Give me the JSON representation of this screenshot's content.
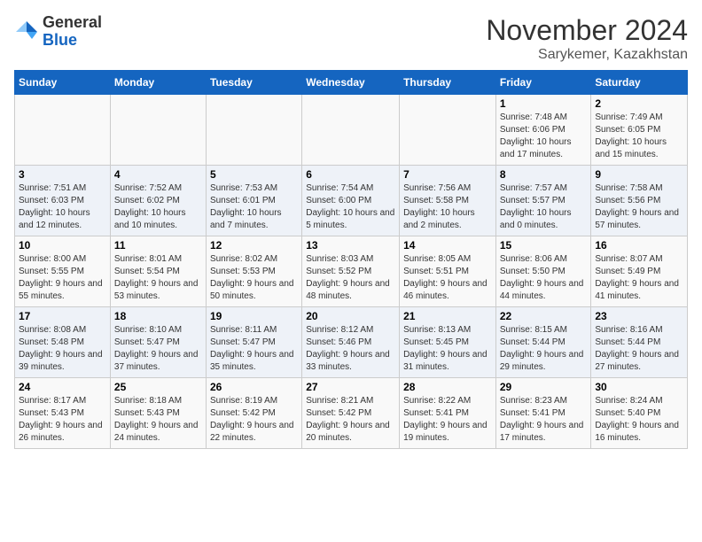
{
  "header": {
    "logo_general": "General",
    "logo_blue": "Blue",
    "month_title": "November 2024",
    "location": "Sarykemer, Kazakhstan"
  },
  "weekdays": [
    "Sunday",
    "Monday",
    "Tuesday",
    "Wednesday",
    "Thursday",
    "Friday",
    "Saturday"
  ],
  "weeks": [
    [
      {
        "day": "",
        "info": ""
      },
      {
        "day": "",
        "info": ""
      },
      {
        "day": "",
        "info": ""
      },
      {
        "day": "",
        "info": ""
      },
      {
        "day": "",
        "info": ""
      },
      {
        "day": "1",
        "info": "Sunrise: 7:48 AM\nSunset: 6:06 PM\nDaylight: 10 hours and 17 minutes."
      },
      {
        "day": "2",
        "info": "Sunrise: 7:49 AM\nSunset: 6:05 PM\nDaylight: 10 hours and 15 minutes."
      }
    ],
    [
      {
        "day": "3",
        "info": "Sunrise: 7:51 AM\nSunset: 6:03 PM\nDaylight: 10 hours and 12 minutes."
      },
      {
        "day": "4",
        "info": "Sunrise: 7:52 AM\nSunset: 6:02 PM\nDaylight: 10 hours and 10 minutes."
      },
      {
        "day": "5",
        "info": "Sunrise: 7:53 AM\nSunset: 6:01 PM\nDaylight: 10 hours and 7 minutes."
      },
      {
        "day": "6",
        "info": "Sunrise: 7:54 AM\nSunset: 6:00 PM\nDaylight: 10 hours and 5 minutes."
      },
      {
        "day": "7",
        "info": "Sunrise: 7:56 AM\nSunset: 5:58 PM\nDaylight: 10 hours and 2 minutes."
      },
      {
        "day": "8",
        "info": "Sunrise: 7:57 AM\nSunset: 5:57 PM\nDaylight: 10 hours and 0 minutes."
      },
      {
        "day": "9",
        "info": "Sunrise: 7:58 AM\nSunset: 5:56 PM\nDaylight: 9 hours and 57 minutes."
      }
    ],
    [
      {
        "day": "10",
        "info": "Sunrise: 8:00 AM\nSunset: 5:55 PM\nDaylight: 9 hours and 55 minutes."
      },
      {
        "day": "11",
        "info": "Sunrise: 8:01 AM\nSunset: 5:54 PM\nDaylight: 9 hours and 53 minutes."
      },
      {
        "day": "12",
        "info": "Sunrise: 8:02 AM\nSunset: 5:53 PM\nDaylight: 9 hours and 50 minutes."
      },
      {
        "day": "13",
        "info": "Sunrise: 8:03 AM\nSunset: 5:52 PM\nDaylight: 9 hours and 48 minutes."
      },
      {
        "day": "14",
        "info": "Sunrise: 8:05 AM\nSunset: 5:51 PM\nDaylight: 9 hours and 46 minutes."
      },
      {
        "day": "15",
        "info": "Sunrise: 8:06 AM\nSunset: 5:50 PM\nDaylight: 9 hours and 44 minutes."
      },
      {
        "day": "16",
        "info": "Sunrise: 8:07 AM\nSunset: 5:49 PM\nDaylight: 9 hours and 41 minutes."
      }
    ],
    [
      {
        "day": "17",
        "info": "Sunrise: 8:08 AM\nSunset: 5:48 PM\nDaylight: 9 hours and 39 minutes."
      },
      {
        "day": "18",
        "info": "Sunrise: 8:10 AM\nSunset: 5:47 PM\nDaylight: 9 hours and 37 minutes."
      },
      {
        "day": "19",
        "info": "Sunrise: 8:11 AM\nSunset: 5:47 PM\nDaylight: 9 hours and 35 minutes."
      },
      {
        "day": "20",
        "info": "Sunrise: 8:12 AM\nSunset: 5:46 PM\nDaylight: 9 hours and 33 minutes."
      },
      {
        "day": "21",
        "info": "Sunrise: 8:13 AM\nSunset: 5:45 PM\nDaylight: 9 hours and 31 minutes."
      },
      {
        "day": "22",
        "info": "Sunrise: 8:15 AM\nSunset: 5:44 PM\nDaylight: 9 hours and 29 minutes."
      },
      {
        "day": "23",
        "info": "Sunrise: 8:16 AM\nSunset: 5:44 PM\nDaylight: 9 hours and 27 minutes."
      }
    ],
    [
      {
        "day": "24",
        "info": "Sunrise: 8:17 AM\nSunset: 5:43 PM\nDaylight: 9 hours and 26 minutes."
      },
      {
        "day": "25",
        "info": "Sunrise: 8:18 AM\nSunset: 5:43 PM\nDaylight: 9 hours and 24 minutes."
      },
      {
        "day": "26",
        "info": "Sunrise: 8:19 AM\nSunset: 5:42 PM\nDaylight: 9 hours and 22 minutes."
      },
      {
        "day": "27",
        "info": "Sunrise: 8:21 AM\nSunset: 5:42 PM\nDaylight: 9 hours and 20 minutes."
      },
      {
        "day": "28",
        "info": "Sunrise: 8:22 AM\nSunset: 5:41 PM\nDaylight: 9 hours and 19 minutes."
      },
      {
        "day": "29",
        "info": "Sunrise: 8:23 AM\nSunset: 5:41 PM\nDaylight: 9 hours and 17 minutes."
      },
      {
        "day": "30",
        "info": "Sunrise: 8:24 AM\nSunset: 5:40 PM\nDaylight: 9 hours and 16 minutes."
      }
    ]
  ]
}
